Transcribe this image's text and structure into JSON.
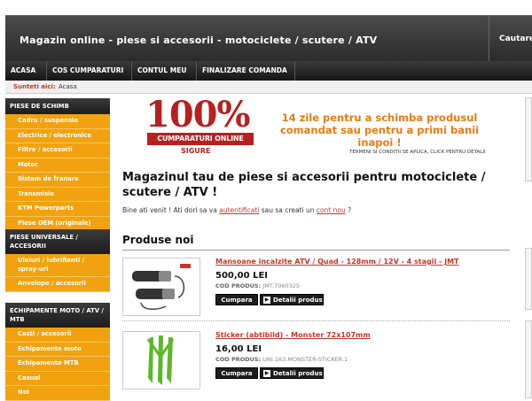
{
  "header": {
    "title": "Magazin online - piese si accesorii - motociclete / scutere / ATV",
    "search_label": "Cautare:"
  },
  "nav": [
    "ACASA",
    "COS CUMPARATURI",
    "CONTUL MEU",
    "FINALIZARE COMANDA"
  ],
  "breadcrumb": {
    "label": "Sunteti aici:",
    "value": "Acasa"
  },
  "sidebar": [
    {
      "title": "PIESE DE SCHIMB",
      "items": [
        "Cadru / suspensie",
        "Electrice / electronice",
        "Filtre / accesorii",
        "Motor",
        "Sistem de franare",
        "Transmisie",
        "KTM Powerparts",
        "Piese OEM (originale)"
      ]
    },
    {
      "title": "PIESE UNIVERSALE / ACCESORII",
      "items": [
        "Uleiuri / lubrifianti / spray-uri",
        "Anvelope / accesorii"
      ]
    },
    {
      "title": "ECHIPAMENTE MOTO / ATV / MTB",
      "items": [
        "Casti / accesorii",
        "Echipamente moto",
        "Echipamente MTB",
        "Casual",
        "Noi"
      ]
    }
  ],
  "banner": {
    "big": "100%",
    "redbar": "CUMPARATURI ONLINE",
    "sub": "SIGURE",
    "text": "14 zile pentru a schimba produsul comandat sau pentru a primi banii inapoi !",
    "note": "TERMENI SI CONDITII SE APLICA, CLICK PENTRU DETALII"
  },
  "welcome": {
    "title": "Magazinul tau de piese si accesorii pentru motociclete / scutere / ATV !",
    "text_before": "Bine ati venit ! Ati dori sa va ",
    "link_login": "autentificati",
    "text_middle": " sau sa creati un ",
    "link_account": "cont nou",
    "text_after": " ?"
  },
  "new_products": {
    "title": "Produse noi",
    "items": [
      {
        "name": "Mansoane incalzite ATV / Quad - 128mm / 12V - 4 stagii - JMT",
        "price": "500,00 LEI",
        "code_label": "COD PRODUS:",
        "code": "JMT.7060325"
      },
      {
        "name": "Sticker (abtibild) - Monster 72x107mm",
        "price": "16,00 LEI",
        "code_label": "COD PRODUS:",
        "code": "UNI.163.MONSTER-STICKER.1"
      }
    ],
    "buy_label": "Cumpara",
    "details_label": "Detalii produs"
  },
  "colors": {
    "accent": "#f2a20e",
    "link": "#c0392b",
    "dark": "#1c1c1c",
    "banner_red": "#b81f1f",
    "banner_orange": "#e77b14"
  }
}
